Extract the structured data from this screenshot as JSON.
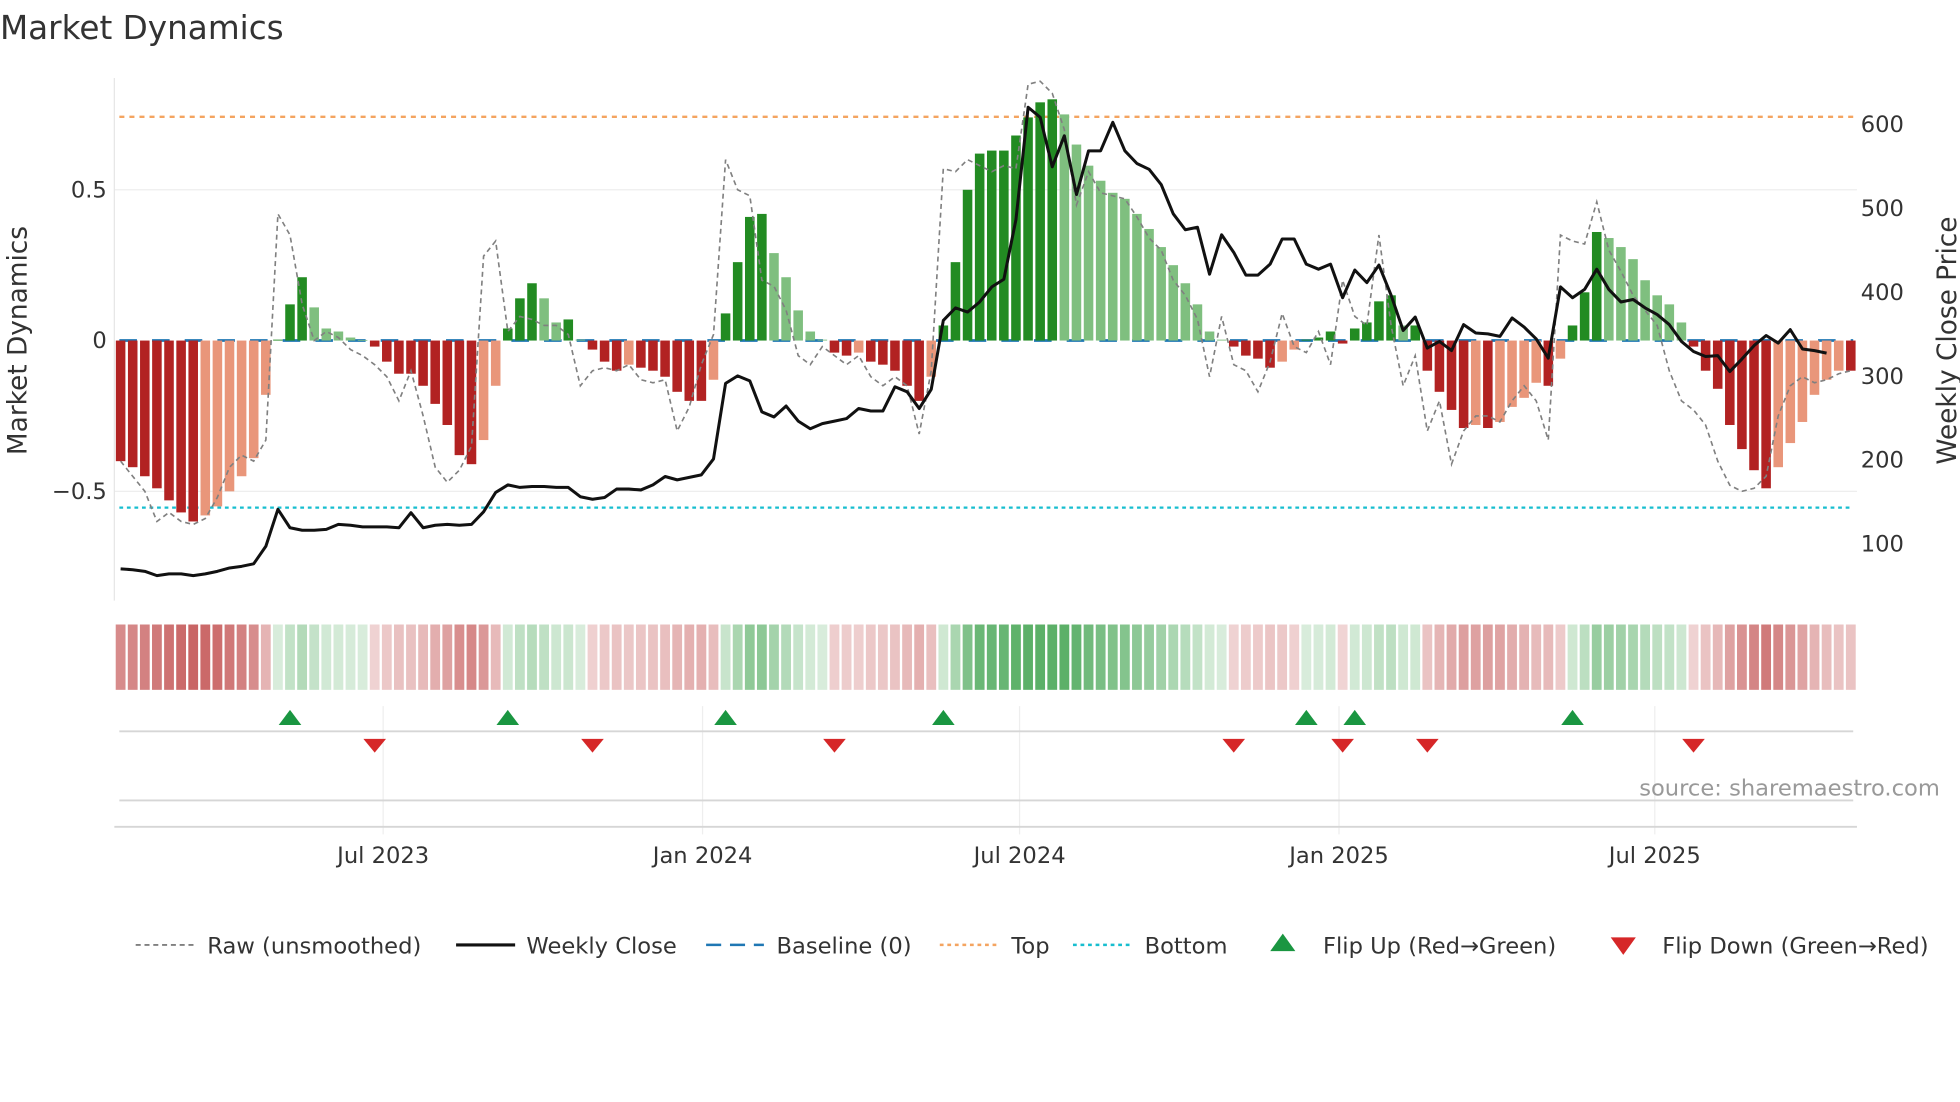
{
  "chart_data": {
    "type": "bar",
    "title": "Market Dynamics",
    "ylabel": "Market Dynamics",
    "ylabel_right": "Weekly Close Price",
    "ylim": [
      -0.85,
      0.86
    ],
    "ylim_right": [
      30,
      650
    ],
    "yticks": [
      {
        "value": 0.5,
        "label": "0.5"
      },
      {
        "value": 0,
        "label": "0"
      },
      {
        "value": -0.5,
        "label": "−0.5"
      }
    ],
    "yticks_right": [
      {
        "value": 600,
        "label": "600"
      },
      {
        "value": 500,
        "label": "500"
      },
      {
        "value": 400,
        "label": "400"
      },
      {
        "value": 300,
        "label": "300"
      },
      {
        "value": 200,
        "label": "200"
      },
      {
        "value": 100,
        "label": "100"
      }
    ],
    "x_unit": "week index",
    "xticks": [
      {
        "week": 21.7,
        "label": "Jul 2023"
      },
      {
        "week": 48.1,
        "label": "Jan 2024"
      },
      {
        "week": 74.3,
        "label": "Jul 2024"
      },
      {
        "week": 100.7,
        "label": "Jan 2025"
      },
      {
        "week": 126.8,
        "label": "Jul 2025"
      }
    ],
    "top_level": 0.742,
    "bottom_level": -0.554,
    "baseline": 0,
    "smoothed": [
      -0.4,
      -0.42,
      -0.45,
      -0.49,
      -0.53,
      -0.57,
      -0.6,
      -0.58,
      -0.55,
      -0.5,
      -0.45,
      -0.39,
      -0.18,
      0.003,
      0.12,
      0.21,
      0.11,
      0.04,
      0.03,
      0.01,
      0.002,
      -0.02,
      -0.07,
      -0.11,
      -0.11,
      -0.15,
      -0.21,
      -0.28,
      -0.38,
      -0.41,
      -0.33,
      -0.15,
      0.04,
      0.14,
      0.19,
      0.14,
      0.06,
      0.07,
      0.003,
      -0.03,
      -0.07,
      -0.1,
      -0.08,
      -0.09,
      -0.1,
      -0.12,
      -0.17,
      -0.2,
      -0.2,
      -0.13,
      0.09,
      0.26,
      0.41,
      0.42,
      0.29,
      0.21,
      0.1,
      0.03,
      0.003,
      -0.04,
      -0.05,
      -0.04,
      -0.07,
      -0.08,
      -0.1,
      -0.15,
      -0.2,
      -0.12,
      0.05,
      0.26,
      0.5,
      0.62,
      0.63,
      0.63,
      0.68,
      0.74,
      0.79,
      0.8,
      0.75,
      0.65,
      0.58,
      0.53,
      0.49,
      0.47,
      0.42,
      0.37,
      0.31,
      0.25,
      0.19,
      0.12,
      0.03,
      0.003,
      -0.02,
      -0.05,
      -0.06,
      -0.09,
      -0.07,
      -0.03,
      0.003,
      0.01,
      0.03,
      -0.01,
      0.04,
      0.06,
      0.13,
      0.15,
      0.05,
      0.05,
      -0.1,
      -0.17,
      -0.23,
      -0.29,
      -0.28,
      -0.29,
      -0.27,
      -0.22,
      -0.19,
      -0.14,
      -0.15,
      -0.06,
      0.05,
      0.16,
      0.36,
      0.34,
      0.31,
      0.27,
      0.2,
      0.15,
      0.12,
      0.06,
      -0.02,
      -0.1,
      -0.16,
      -0.28,
      -0.36,
      -0.43,
      -0.49,
      -0.42,
      -0.34,
      -0.27,
      -0.18,
      -0.13,
      -0.1,
      -0.1
    ],
    "raw": [
      -0.4,
      -0.45,
      -0.5,
      -0.6,
      -0.57,
      -0.6,
      -0.61,
      -0.59,
      -0.52,
      -0.42,
      -0.38,
      -0.4,
      -0.33,
      0.42,
      0.35,
      0.12,
      0,
      0.03,
      0.01,
      -0.03,
      -0.05,
      -0.08,
      -0.12,
      -0.2,
      -0.1,
      -0.25,
      -0.42,
      -0.47,
      -0.43,
      -0.35,
      0.28,
      0.33,
      0.03,
      0.08,
      0.07,
      0.05,
      0.05,
      0.02,
      -0.15,
      -0.1,
      -0.09,
      -0.1,
      -0.08,
      -0.13,
      -0.14,
      -0.13,
      -0.3,
      -0.22,
      -0.08,
      0.02,
      0.6,
      0.5,
      0.48,
      0.2,
      0.18,
      0.1,
      -0.05,
      -0.08,
      -0.02,
      -0.05,
      -0.08,
      -0.05,
      -0.12,
      -0.15,
      -0.12,
      -0.15,
      -0.31,
      -0.1,
      0.57,
      0.56,
      0.6,
      0.58,
      0.56,
      0.58,
      0.57,
      0.85,
      0.86,
      0.82,
      0.7,
      0.45,
      0.56,
      0.49,
      0.48,
      0.47,
      0.41,
      0.34,
      0.3,
      0.2,
      0.15,
      0.07,
      -0.12,
      0.08,
      -0.08,
      -0.1,
      -0.17,
      -0.07,
      0.09,
      -0.02,
      -0.04,
      0.03,
      -0.08,
      0.2,
      0.08,
      0.05,
      0.35,
      0.05,
      -0.15,
      -0.05,
      -0.3,
      -0.2,
      -0.41,
      -0.3,
      -0.25,
      -0.25,
      -0.27,
      -0.2,
      -0.15,
      -0.2,
      -0.33,
      0.35,
      0.33,
      0.32,
      0.46,
      0.3,
      0.23,
      0.15,
      0.1,
      0.05,
      -0.1,
      -0.2,
      -0.23,
      -0.28,
      -0.4,
      -0.48,
      -0.5,
      -0.49,
      -0.45,
      -0.25,
      -0.15,
      -0.12,
      -0.14,
      -0.13,
      -0.11,
      -0.1
    ],
    "weekly_close": [
      69,
      68,
      66,
      61,
      63,
      63,
      61,
      63,
      66,
      70,
      72,
      75,
      96,
      140,
      118,
      115,
      115,
      116,
      122,
      121,
      119,
      119,
      119,
      118,
      136,
      118,
      121,
      122,
      121,
      122,
      137,
      160,
      169,
      166,
      167,
      167,
      166,
      166,
      155,
      152,
      154,
      164,
      164,
      163,
      169,
      179,
      175,
      178,
      181,
      200,
      290,
      299,
      293,
      256,
      250,
      263,
      245,
      236,
      242,
      245,
      248,
      260,
      257,
      257,
      286,
      280,
      260,
      283,
      365,
      380,
      375,
      387,
      405,
      414,
      485,
      619,
      607,
      548,
      585,
      515,
      567,
      567,
      601,
      567,
      552,
      545,
      527,
      492,
      473,
      476,
      420,
      467,
      446,
      419,
      419,
      432,
      462,
      462,
      432,
      426,
      432,
      392,
      425,
      410,
      431,
      395,
      353,
      369,
      332,
      340,
      329,
      360,
      350,
      349,
      346,
      368,
      357,
      343,
      320,
      405,
      392,
      402,
      426,
      402,
      387,
      390,
      380,
      372,
      360,
      340,
      328,
      322,
      323,
      304,
      319,
      335,
      347,
      338,
      354,
      331,
      329,
      326
    ],
    "flip_up_weeks": [
      14,
      32,
      50,
      68,
      98,
      102,
      120
    ],
    "flip_down_weeks": [
      21,
      39,
      59,
      92,
      101,
      108,
      130
    ],
    "colors": {
      "strong_up": "#228b22",
      "weak_up": "#7fbf7f",
      "strong_down": "#b22222",
      "weak_down": "#e9967a",
      "raw": "#808080",
      "close": "#111111",
      "baseline": "#1f77b4",
      "top": "#f4a460",
      "bottom": "#17becf",
      "flip_up": "#1a9641",
      "flip_down": "#d62728"
    },
    "legend": [
      "Raw (unsmoothed)",
      "Weekly Close",
      "Baseline (0)",
      "Top",
      "Bottom",
      "Flip Up (Red→Green)",
      "Flip Down (Green→Red)"
    ],
    "legend_placement": "bottom"
  },
  "source": "source: sharemaestro.com"
}
